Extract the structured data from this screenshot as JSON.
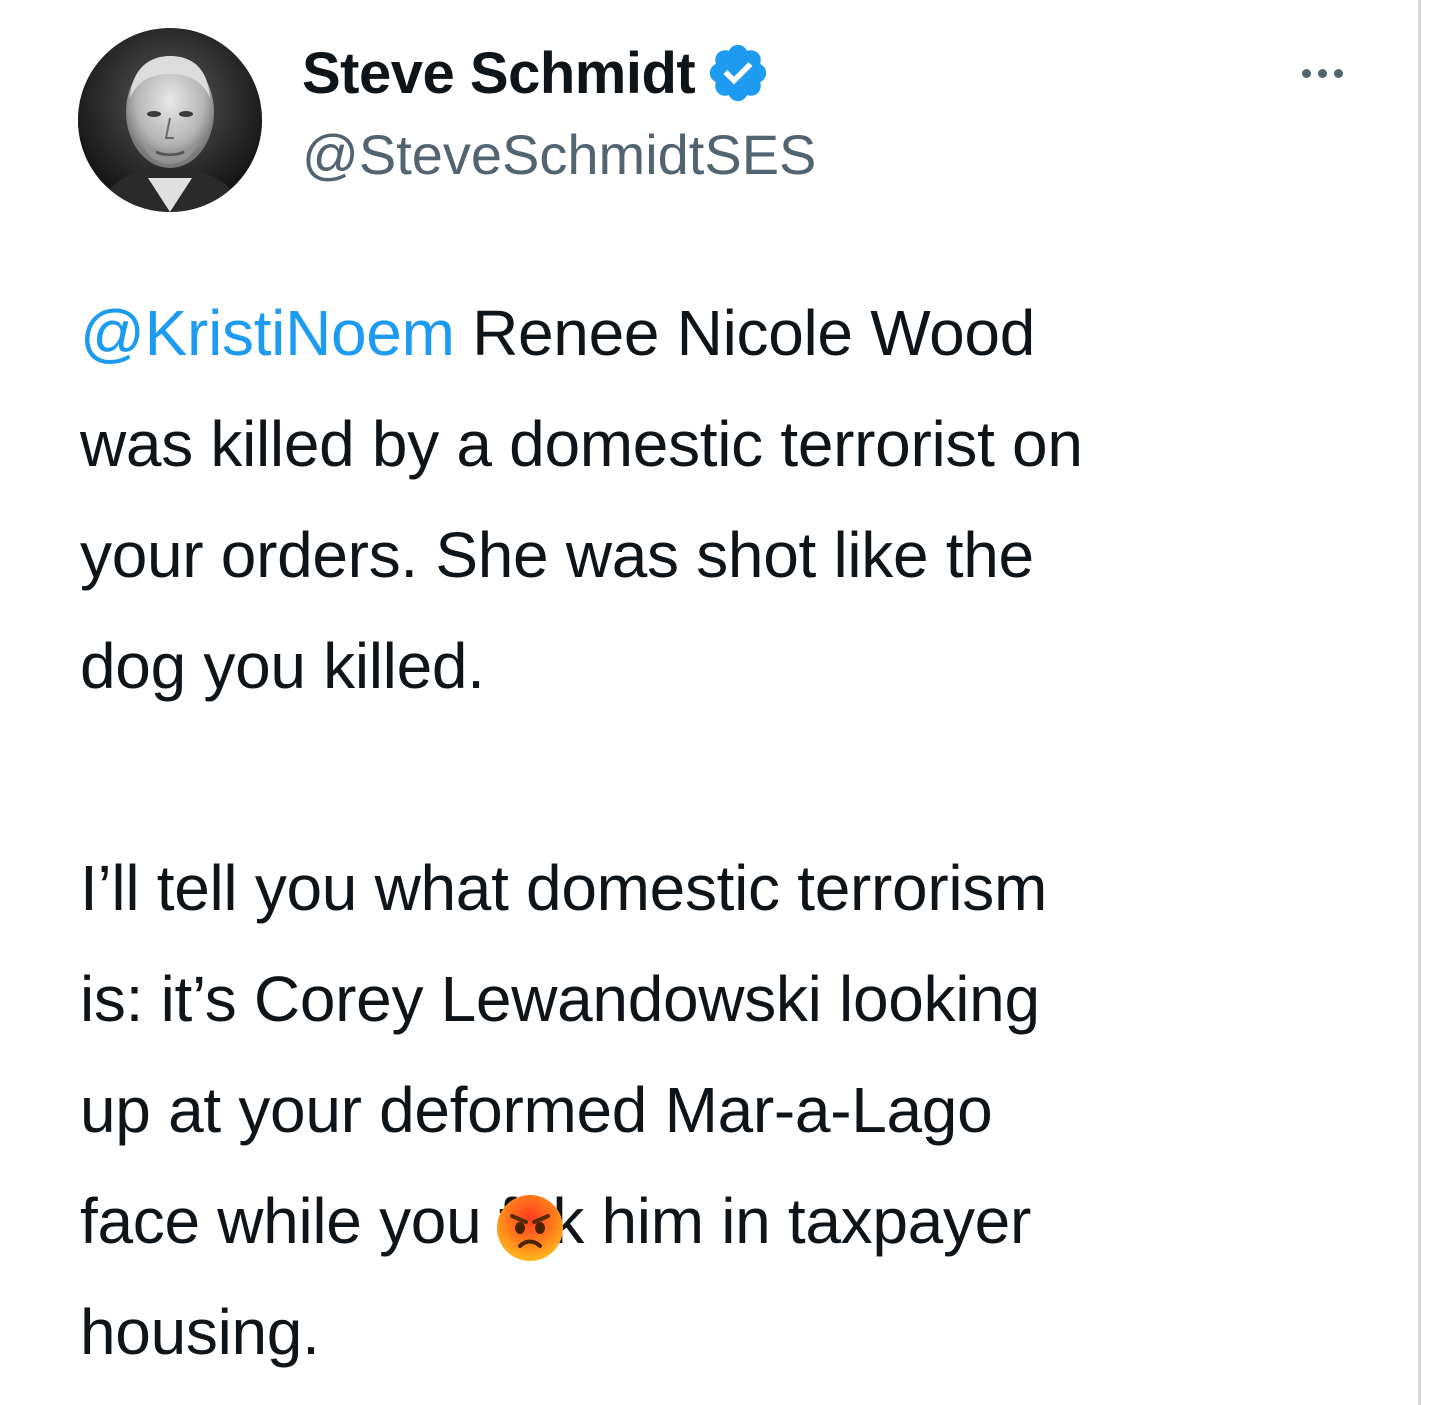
{
  "tweet": {
    "author": {
      "display_name": "Steve Schmidt",
      "handle": "@SteveSchmidtSES",
      "verified": true,
      "verified_icon": "verified-badge-icon",
      "avatar_icon": "avatar-photo"
    },
    "more_icon": "more-options-icon",
    "mention": "@KristiNoem",
    "paragraph1_rest": " Renee Nicole Wood\nwas killed by a domestic terrorist on\nyour orders. She was shot like the\ndog you killed.",
    "paragraph2_part1": "I’ll tell you what domestic terrorism\nis: it’s Corey Lewandowski looking\nup at your deformed Mar-a-Lago\nface while you f",
    "censor_emoji": "angry-face-emoji",
    "paragraph2_part2": "k him in taxpayer\nhousing."
  },
  "colors": {
    "text": "#0f1419",
    "secondary": "#536471",
    "link": "#1d9bf0",
    "verified": "#1d9bf0"
  }
}
